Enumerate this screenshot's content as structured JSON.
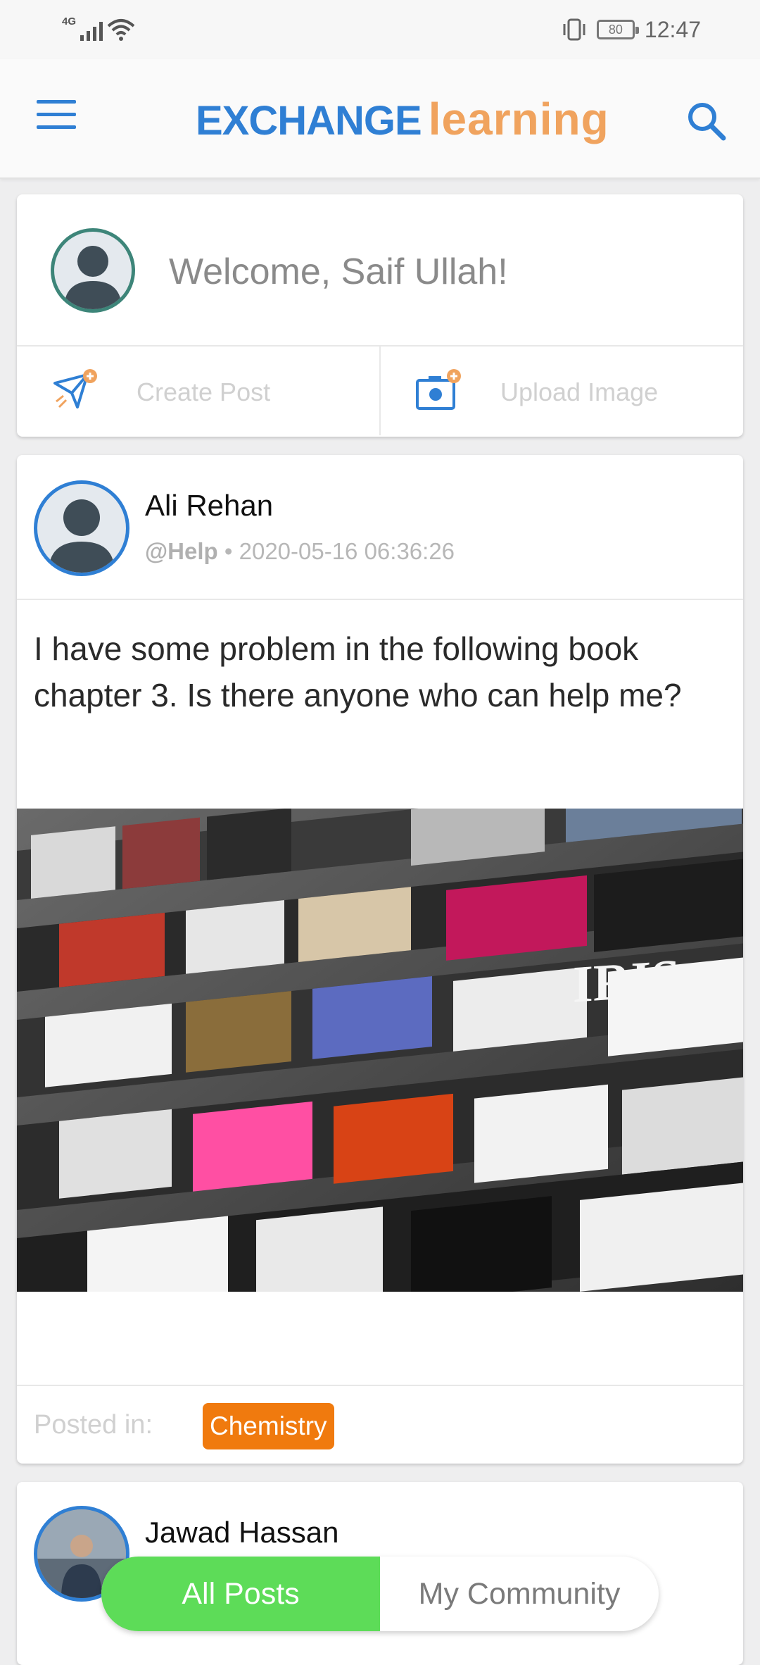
{
  "status_bar": {
    "network": "4G",
    "battery": "80",
    "time": "12:47"
  },
  "app_bar": {
    "logo_part1": "EXCHANGE",
    "logo_part2": "learning",
    "colors": {
      "primary": "#2f7fd4",
      "accent": "#f0a35e"
    },
    "menu_icon": "hamburger-menu-icon",
    "search_icon": "search-icon"
  },
  "welcome": {
    "text": "Welcome, Saif Ullah!",
    "actions": [
      {
        "label": "Create Post",
        "icon": "paper-plane-plus-icon"
      },
      {
        "label": "Upload Image",
        "icon": "camera-plus-icon"
      }
    ]
  },
  "posts": [
    {
      "author": "Ali Rehan",
      "tag": "@Help",
      "timestamp": "2020-05-16 06:36:26",
      "body": "I have some problem in the following book chapter 3. Is there anyone who can help me?",
      "image": "magazine-rack-photo",
      "posted_in_label": "Posted in:",
      "category": "Chemistry",
      "category_color": "#f07a0e"
    },
    {
      "author": "Jawad Hassan"
    }
  ],
  "bottom_toggle": {
    "tabs": [
      {
        "label": "All Posts",
        "active": true
      },
      {
        "label": "My Community",
        "active": false
      }
    ],
    "active_color": "#5ddc58"
  }
}
